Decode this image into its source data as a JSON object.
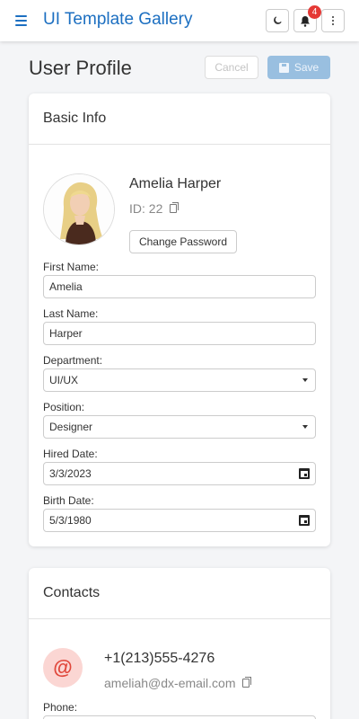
{
  "header": {
    "app_title": "UI Template Gallery",
    "menu_icon": "hamburger-menu-icon",
    "theme_icon": "moon-icon",
    "notifications_icon": "bell-icon",
    "notifications_count": "4",
    "more_icon": "more-vertical-icon",
    "accent_color": "#1c6fc1"
  },
  "page": {
    "title": "User Profile",
    "cancel_label": "Cancel",
    "save_label": "Save"
  },
  "basic_info": {
    "title": "Basic Info",
    "name": "Amelia Harper",
    "id_text": "ID: 22",
    "change_password_label": "Change Password",
    "fields": {
      "first_name": {
        "label": "First Name:",
        "value": "Amelia"
      },
      "last_name": {
        "label": "Last Name:",
        "value": "Harper"
      },
      "department": {
        "label": "Department:",
        "value": "UI/UX"
      },
      "position": {
        "label": "Position:",
        "value": "Designer"
      },
      "hired_date": {
        "label": "Hired Date:",
        "value": "3/3/2023"
      },
      "birth_date": {
        "label": "Birth Date:",
        "value": "5/3/1980"
      }
    }
  },
  "contacts": {
    "title": "Contacts",
    "icon": "at-sign-icon",
    "phone": "+1(213)555-4276",
    "email": "ameliah@dx-email.com",
    "phone_label": "Phone:"
  }
}
